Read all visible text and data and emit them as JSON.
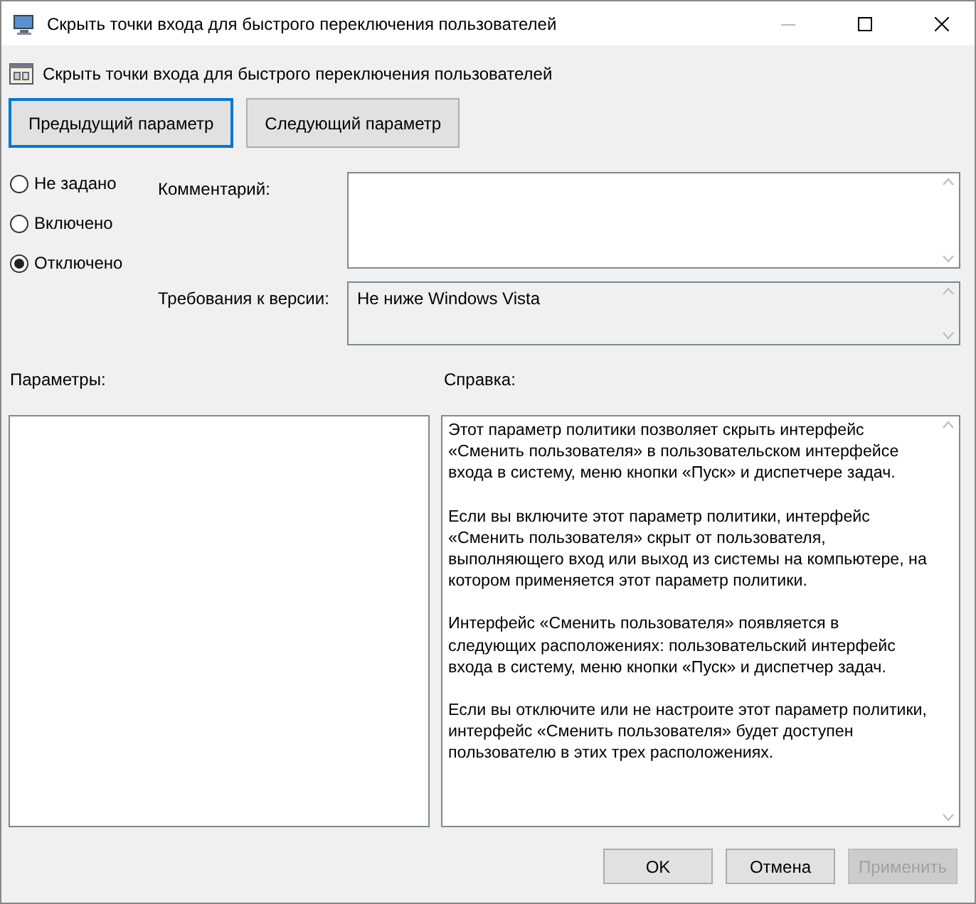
{
  "window": {
    "title": "Скрыть точки входа для быстрого переключения пользователей"
  },
  "policy_title": "Скрыть точки входа для быстрого переключения пользователей",
  "nav_buttons": [
    {
      "label": "Предыдущий параметр",
      "focused": true
    },
    {
      "label": "Следующий параметр",
      "focused": false
    }
  ],
  "state_options": [
    {
      "label": "Не задано",
      "selected": false
    },
    {
      "label": "Включено",
      "selected": false
    },
    {
      "label": "Отключено",
      "selected": true
    }
  ],
  "comment": {
    "label": "Комментарий:"
  },
  "requirements": {
    "label": "Требования к версии:",
    "value": "Не ниже Windows Vista"
  },
  "options": {
    "label": "Параметры:"
  },
  "help": {
    "label": "Справка:",
    "paragraphs": [
      "Этот параметр политики позволяет скрыть интерфейс «Сменить пользователя» в пользовательском интерфейсе входа в систему, меню кнопки «Пуск» и диспетчере задач.",
      "Если вы включите этот параметр политики, интерфейс «Сменить пользователя» скрыт от пользователя, выполняющего вход или выход из системы на компьютере, на котором применяется этот параметр политики.",
      "Интерфейс «Сменить пользователя» появляется в следующих расположениях: пользовательский интерфейс входа в систему, меню кнопки «Пуск» и диспетчер задач.",
      "Если вы отключите или не настроите этот параметр политики, интерфейс «Сменить пользователя» будет доступен пользователю в этих трех расположениях."
    ]
  },
  "dialog_buttons": [
    {
      "label": "OK",
      "disabled": false
    },
    {
      "label": "Отмена",
      "disabled": false
    },
    {
      "label": "Применить",
      "disabled": true
    }
  ]
}
